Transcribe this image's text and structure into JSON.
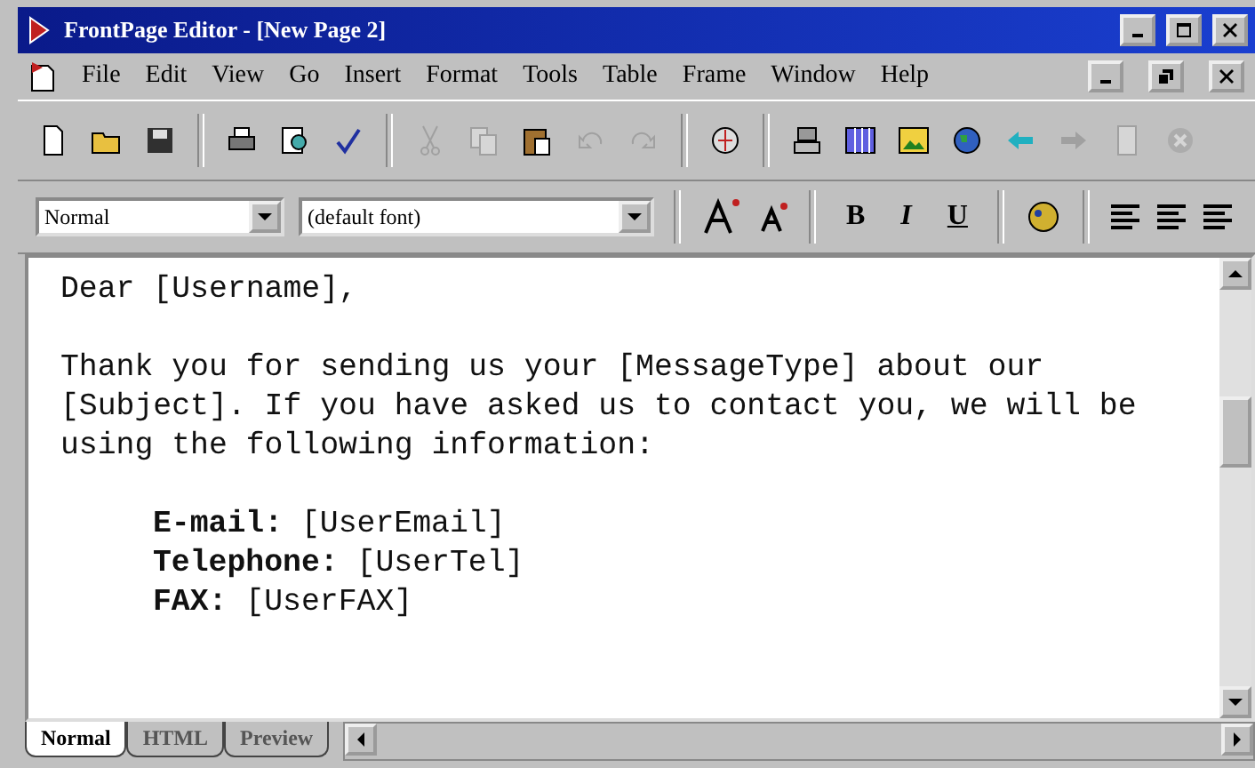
{
  "window": {
    "title": "FrontPage Editor - [New Page 2]"
  },
  "menu": [
    "File",
    "Edit",
    "View",
    "Go",
    "Insert",
    "Format",
    "Tools",
    "Table",
    "Frame",
    "Window",
    "Help"
  ],
  "toolbar": [
    {
      "kind": "new",
      "disabled": false
    },
    {
      "kind": "open",
      "disabled": false
    },
    {
      "kind": "save",
      "disabled": false
    },
    {
      "kind": "sep"
    },
    {
      "kind": "print",
      "disabled": false
    },
    {
      "kind": "preview",
      "disabled": false
    },
    {
      "kind": "spell",
      "disabled": false
    },
    {
      "kind": "sep"
    },
    {
      "kind": "cut",
      "disabled": true
    },
    {
      "kind": "copy",
      "disabled": true
    },
    {
      "kind": "paste",
      "disabled": false
    },
    {
      "kind": "undo",
      "disabled": true
    },
    {
      "kind": "redo",
      "disabled": true
    },
    {
      "kind": "sep"
    },
    {
      "kind": "bot",
      "disabled": false
    },
    {
      "kind": "sep"
    },
    {
      "kind": "table",
      "disabled": false
    },
    {
      "kind": "columns",
      "disabled": false
    },
    {
      "kind": "image",
      "disabled": false
    },
    {
      "kind": "globe",
      "disabled": false
    },
    {
      "kind": "back",
      "disabled": false
    },
    {
      "kind": "forward",
      "disabled": true
    },
    {
      "kind": "refresh",
      "disabled": true
    },
    {
      "kind": "stop",
      "disabled": true
    }
  ],
  "format_bar": {
    "style": "Normal",
    "font": "(default font)",
    "buttons": [
      {
        "label": "B",
        "kind": "bold"
      },
      {
        "label": "I",
        "kind": "italic"
      },
      {
        "label": "U",
        "kind": "underline"
      }
    ]
  },
  "document": {
    "paragraphs": [
      [
        "Dear [Username],"
      ],
      [
        "Thank you for sending us your [MessageType] about our",
        "[Subject]. If you have asked us to contact you, we will be",
        "using the following information:"
      ]
    ],
    "fields": [
      "**E-mail:** [UserEmail]",
      "**Telephone:** [UserTel]",
      "**FAX:** [UserFAX]"
    ]
  },
  "view_tabs": [
    {
      "label": "Normal",
      "selected": true
    },
    {
      "label": "HTML",
      "selected": false
    },
    {
      "label": "Preview",
      "selected": false
    }
  ]
}
